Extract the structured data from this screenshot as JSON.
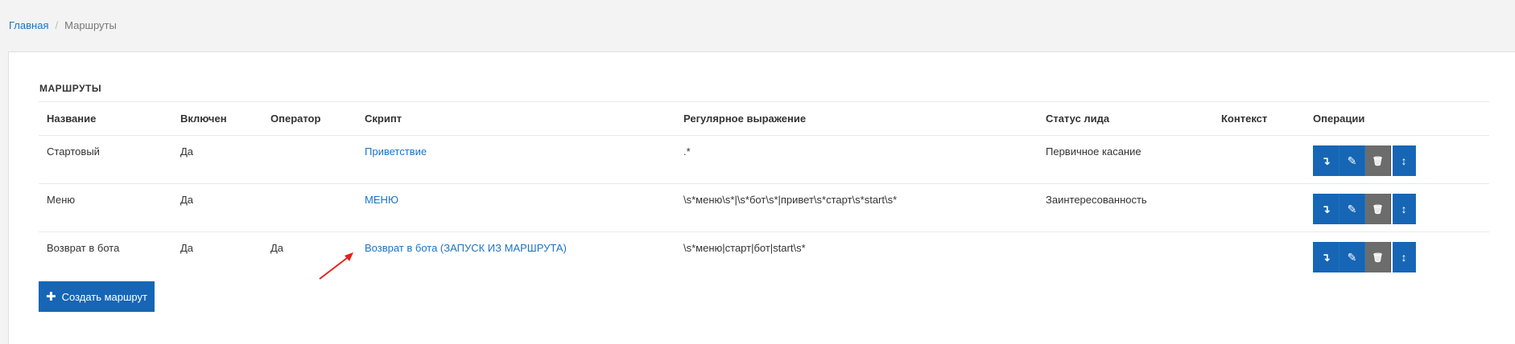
{
  "breadcrumb": {
    "home": "Главная",
    "current": "Маршруты"
  },
  "panel": {
    "title": "МАРШРУТЫ"
  },
  "table": {
    "headers": {
      "name": "Название",
      "enabled": "Включен",
      "operator": "Оператор",
      "script": "Скрипт",
      "regex": "Регулярное выражение",
      "lead_status": "Статус лида",
      "context": "Контекст",
      "operations": "Операции"
    },
    "rows": [
      {
        "name": "Стартовый",
        "enabled": "Да",
        "operator": "",
        "script": "Приветствие",
        "regex": ".*",
        "lead_status": "Первичное касание",
        "context": ""
      },
      {
        "name": "Меню",
        "enabled": "Да",
        "operator": "",
        "script": "МЕНЮ",
        "regex": "\\s*меню\\s*|\\s*бот\\s*|привет\\s*старт\\s*start\\s*",
        "lead_status": "Заинтересованность",
        "context": ""
      },
      {
        "name": "Возврат в бота",
        "enabled": "Да",
        "operator": "Да",
        "script": "Возврат в бота (ЗАПУСК ИЗ МАРШРУТА)",
        "regex": "\\s*меню|старт|бот|start\\s*",
        "lead_status": "",
        "context": ""
      }
    ],
    "operation_icons": [
      "move-down-icon",
      "edit-icon",
      "trash-icon",
      "sort-icon"
    ]
  },
  "create_button": {
    "label": "Создать маршрут",
    "icon": "plus-icon"
  },
  "colors": {
    "accent": "#1666b5",
    "link": "#1a73c6",
    "delete_button": "#6c6c6c",
    "annotation_arrow": "#e3221c"
  }
}
